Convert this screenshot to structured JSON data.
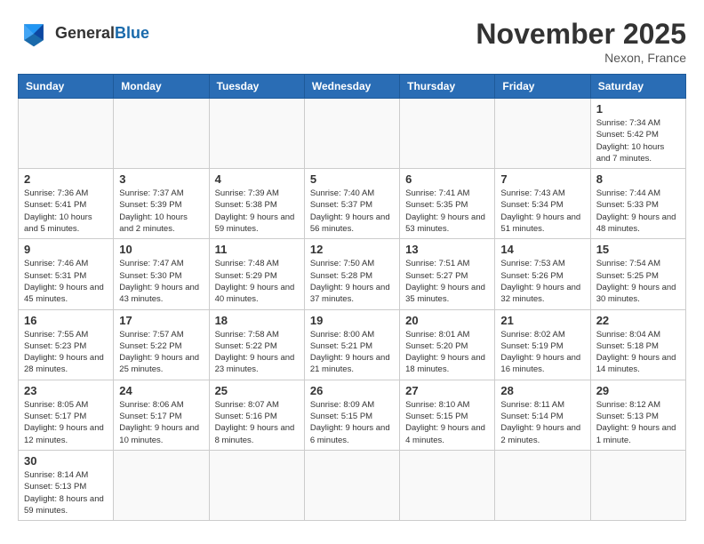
{
  "header": {
    "logo_general": "General",
    "logo_blue": "Blue",
    "month": "November 2025",
    "location": "Nexon, France"
  },
  "weekdays": [
    "Sunday",
    "Monday",
    "Tuesday",
    "Wednesday",
    "Thursday",
    "Friday",
    "Saturday"
  ],
  "weeks": [
    [
      {
        "day": "",
        "info": ""
      },
      {
        "day": "",
        "info": ""
      },
      {
        "day": "",
        "info": ""
      },
      {
        "day": "",
        "info": ""
      },
      {
        "day": "",
        "info": ""
      },
      {
        "day": "",
        "info": ""
      },
      {
        "day": "1",
        "info": "Sunrise: 7:34 AM\nSunset: 5:42 PM\nDaylight: 10 hours\nand 7 minutes."
      }
    ],
    [
      {
        "day": "2",
        "info": "Sunrise: 7:36 AM\nSunset: 5:41 PM\nDaylight: 10 hours\nand 5 minutes."
      },
      {
        "day": "3",
        "info": "Sunrise: 7:37 AM\nSunset: 5:39 PM\nDaylight: 10 hours\nand 2 minutes."
      },
      {
        "day": "4",
        "info": "Sunrise: 7:39 AM\nSunset: 5:38 PM\nDaylight: 9 hours\nand 59 minutes."
      },
      {
        "day": "5",
        "info": "Sunrise: 7:40 AM\nSunset: 5:37 PM\nDaylight: 9 hours\nand 56 minutes."
      },
      {
        "day": "6",
        "info": "Sunrise: 7:41 AM\nSunset: 5:35 PM\nDaylight: 9 hours\nand 53 minutes."
      },
      {
        "day": "7",
        "info": "Sunrise: 7:43 AM\nSunset: 5:34 PM\nDaylight: 9 hours\nand 51 minutes."
      },
      {
        "day": "8",
        "info": "Sunrise: 7:44 AM\nSunset: 5:33 PM\nDaylight: 9 hours\nand 48 minutes."
      }
    ],
    [
      {
        "day": "9",
        "info": "Sunrise: 7:46 AM\nSunset: 5:31 PM\nDaylight: 9 hours\nand 45 minutes."
      },
      {
        "day": "10",
        "info": "Sunrise: 7:47 AM\nSunset: 5:30 PM\nDaylight: 9 hours\nand 43 minutes."
      },
      {
        "day": "11",
        "info": "Sunrise: 7:48 AM\nSunset: 5:29 PM\nDaylight: 9 hours\nand 40 minutes."
      },
      {
        "day": "12",
        "info": "Sunrise: 7:50 AM\nSunset: 5:28 PM\nDaylight: 9 hours\nand 37 minutes."
      },
      {
        "day": "13",
        "info": "Sunrise: 7:51 AM\nSunset: 5:27 PM\nDaylight: 9 hours\nand 35 minutes."
      },
      {
        "day": "14",
        "info": "Sunrise: 7:53 AM\nSunset: 5:26 PM\nDaylight: 9 hours\nand 32 minutes."
      },
      {
        "day": "15",
        "info": "Sunrise: 7:54 AM\nSunset: 5:25 PM\nDaylight: 9 hours\nand 30 minutes."
      }
    ],
    [
      {
        "day": "16",
        "info": "Sunrise: 7:55 AM\nSunset: 5:23 PM\nDaylight: 9 hours\nand 28 minutes."
      },
      {
        "day": "17",
        "info": "Sunrise: 7:57 AM\nSunset: 5:22 PM\nDaylight: 9 hours\nand 25 minutes."
      },
      {
        "day": "18",
        "info": "Sunrise: 7:58 AM\nSunset: 5:22 PM\nDaylight: 9 hours\nand 23 minutes."
      },
      {
        "day": "19",
        "info": "Sunrise: 8:00 AM\nSunset: 5:21 PM\nDaylight: 9 hours\nand 21 minutes."
      },
      {
        "day": "20",
        "info": "Sunrise: 8:01 AM\nSunset: 5:20 PM\nDaylight: 9 hours\nand 18 minutes."
      },
      {
        "day": "21",
        "info": "Sunrise: 8:02 AM\nSunset: 5:19 PM\nDaylight: 9 hours\nand 16 minutes."
      },
      {
        "day": "22",
        "info": "Sunrise: 8:04 AM\nSunset: 5:18 PM\nDaylight: 9 hours\nand 14 minutes."
      }
    ],
    [
      {
        "day": "23",
        "info": "Sunrise: 8:05 AM\nSunset: 5:17 PM\nDaylight: 9 hours\nand 12 minutes."
      },
      {
        "day": "24",
        "info": "Sunrise: 8:06 AM\nSunset: 5:17 PM\nDaylight: 9 hours\nand 10 minutes."
      },
      {
        "day": "25",
        "info": "Sunrise: 8:07 AM\nSunset: 5:16 PM\nDaylight: 9 hours\nand 8 minutes."
      },
      {
        "day": "26",
        "info": "Sunrise: 8:09 AM\nSunset: 5:15 PM\nDaylight: 9 hours\nand 6 minutes."
      },
      {
        "day": "27",
        "info": "Sunrise: 8:10 AM\nSunset: 5:15 PM\nDaylight: 9 hours\nand 4 minutes."
      },
      {
        "day": "28",
        "info": "Sunrise: 8:11 AM\nSunset: 5:14 PM\nDaylight: 9 hours\nand 2 minutes."
      },
      {
        "day": "29",
        "info": "Sunrise: 8:12 AM\nSunset: 5:13 PM\nDaylight: 9 hours\nand 1 minute."
      }
    ],
    [
      {
        "day": "30",
        "info": "Sunrise: 8:14 AM\nSunset: 5:13 PM\nDaylight: 8 hours\nand 59 minutes."
      },
      {
        "day": "",
        "info": ""
      },
      {
        "day": "",
        "info": ""
      },
      {
        "day": "",
        "info": ""
      },
      {
        "day": "",
        "info": ""
      },
      {
        "day": "",
        "info": ""
      },
      {
        "day": "",
        "info": ""
      }
    ]
  ]
}
